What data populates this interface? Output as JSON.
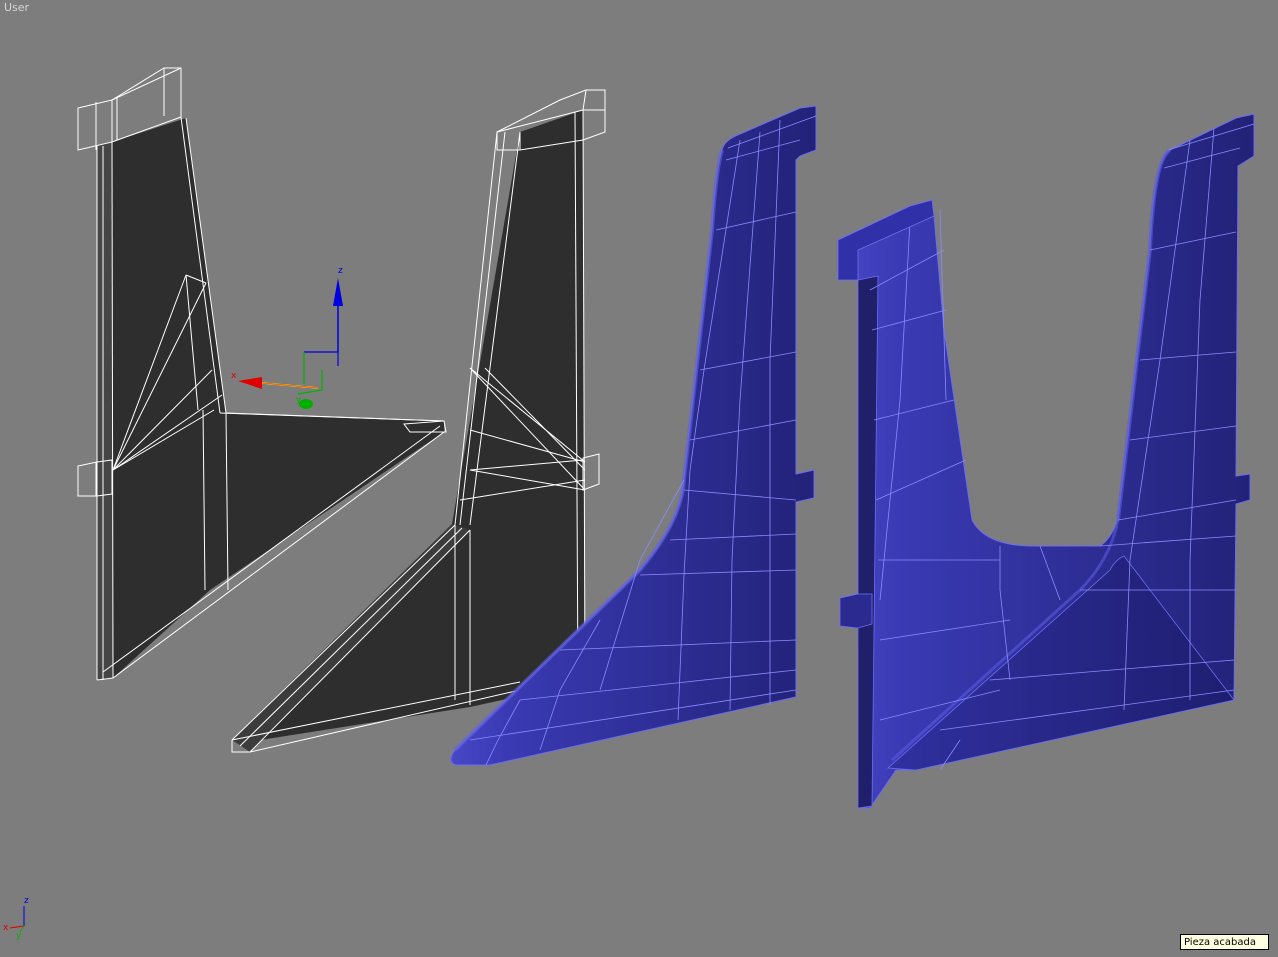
{
  "viewport": {
    "label": "User",
    "background": "#7d7d7d"
  },
  "tooltip": {
    "text": "Pieza acabada"
  },
  "gizmo": {
    "x_label": "x",
    "y_label": "y",
    "z_label": "z"
  },
  "axis_tripod": {
    "x_label": "x",
    "y_label": "y",
    "z_label": "z"
  },
  "colors": {
    "wire": "#ffffff",
    "wire_fill": "#2e2e2e",
    "mesh_fill": "#2c2c8c",
    "mesh_edge": "#8080ff",
    "axis_x": "#e00000",
    "axis_y": "#00b000",
    "axis_z": "#0000e0",
    "gizmo_yellow": "#ffd700"
  },
  "icons": [
    "transform-gizmo-icon",
    "axis-tripod-icon"
  ]
}
